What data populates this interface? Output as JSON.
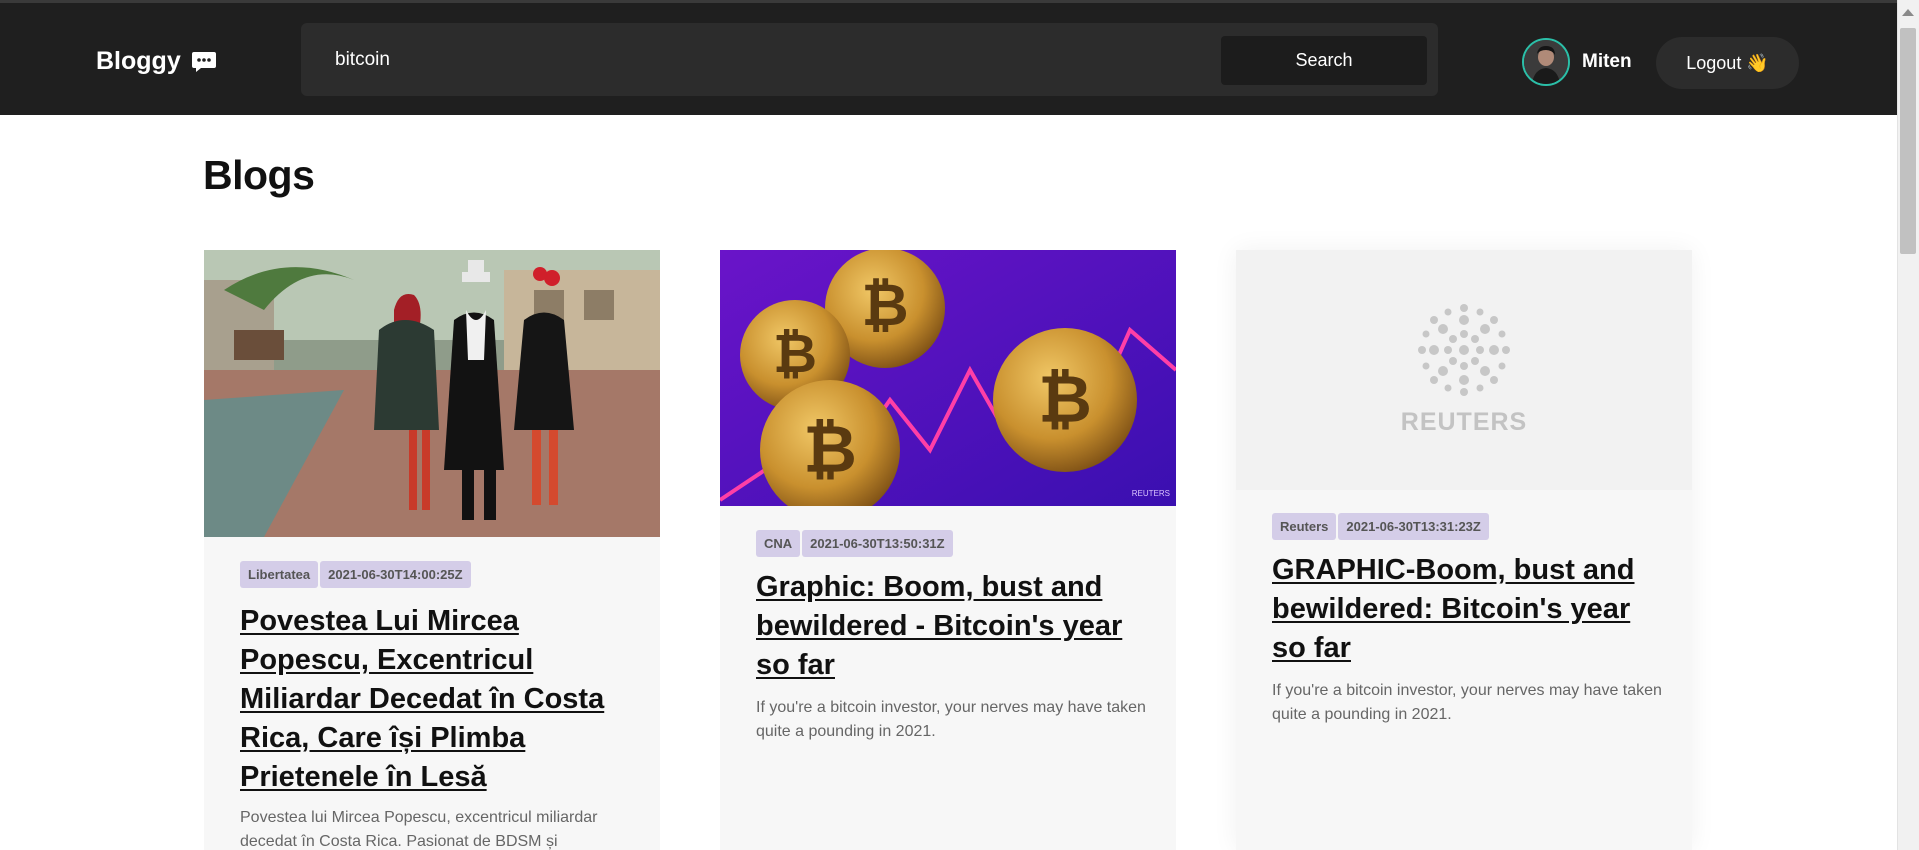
{
  "navbar": {
    "brand": "Bloggy",
    "search_value": "bitcoin",
    "search_button": "Search",
    "username": "Miten",
    "logout_label": "Logout 👋"
  },
  "main": {
    "title": "Blogs",
    "cards": [
      {
        "source": "Libertatea",
        "date": "2021-06-30T14:00:25Z",
        "title": "Povestea Lui Mircea Popescu, Excentricul Miliardar Decedat în Costa Rica, Care își Plimba Prietenele în Lesă",
        "description": "Povestea lui Mircea Popescu, excentricul miliardar decedat în Costa Rica. Pasionat de BDSM și"
      },
      {
        "source": "CNA",
        "date": "2021-06-30T13:50:31Z",
        "title": "Graphic: Boom, bust and bewildered - Bitcoin's year so far",
        "description": "If you're a bitcoin investor, your nerves may have taken quite a pounding in 2021.",
        "image_watermark": "REUTERS"
      },
      {
        "source": "Reuters",
        "date": "2021-06-30T13:31:23Z",
        "title": "GRAPHIC-Boom, bust and bewildered: Bitcoin's year so far",
        "description": "If you're a bitcoin investor, your nerves may have taken quite a pounding in 2021.",
        "image_logo_text": "REUTERS"
      }
    ]
  },
  "colors": {
    "navbar_bg": "#1f1f1f",
    "tag_bg": "#d4cde8",
    "avatar_ring": "#2bbfa8"
  }
}
